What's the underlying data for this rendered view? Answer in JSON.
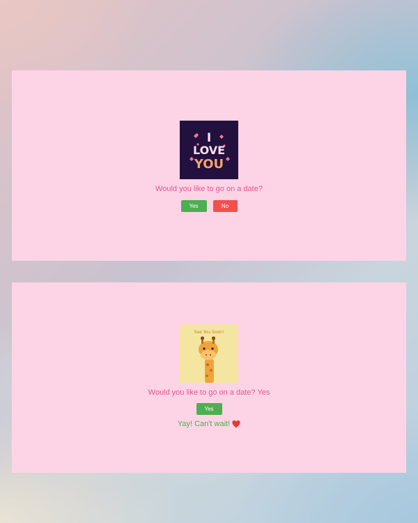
{
  "card1": {
    "image": {
      "icon": "i-love-you-image",
      "text_line1": "I",
      "text_line2": "LOVE",
      "text_line3": "YOU",
      "bg_color": "#22103f"
    },
    "question": "Would you like to go on a date?",
    "yes_label": "Yes",
    "no_label": "No"
  },
  "card2": {
    "image": {
      "icon": "giraffe-image",
      "caption": "See You Soon!",
      "bg_color": "#f4e6a0"
    },
    "question": "Would you like to go on a date? Yes",
    "yes_label": "Yes",
    "success": "Yay! Can't wait!",
    "success_icon": "red-heart-icon"
  },
  "colors": {
    "card_bg": "#fdd4e6",
    "question_text": "#e6548f",
    "yes_button": "#4caf50",
    "no_button": "#f44f4f",
    "success_text": "#4caf50"
  }
}
